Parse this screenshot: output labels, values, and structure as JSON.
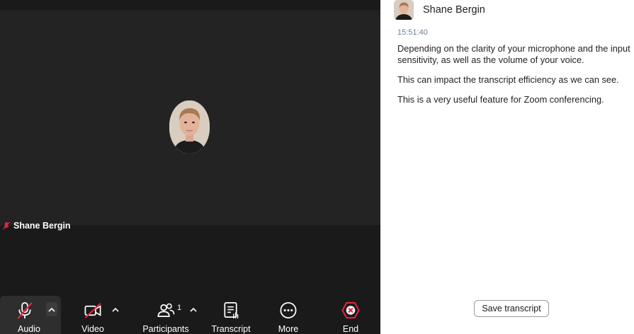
{
  "participant": {
    "name": "Shane Bergin"
  },
  "toolbar": {
    "audio_label": "Audio",
    "video_label": "Video",
    "participants_label": "Participants",
    "participants_count": "1",
    "transcript_label": "Transcript",
    "more_label": "More",
    "end_label": "End",
    "caret": "^"
  },
  "panel": {
    "speaker_name": "Shane Bergin",
    "timestamp": "15:51:40",
    "lines": [
      "Depending on the clarity of your microphone and the input sensitivity, as well as the volume of your voice.",
      "This can impact the transcript efficiency as we can see.",
      "This is a very useful feature for Zoom conferencing."
    ],
    "save_label": "Save transcript"
  },
  "colors": {
    "meeting_bg": "#1a1a1a",
    "tile_bg": "#232323",
    "muted_red": "#e8253f",
    "timestamp": "#6e7f96"
  }
}
